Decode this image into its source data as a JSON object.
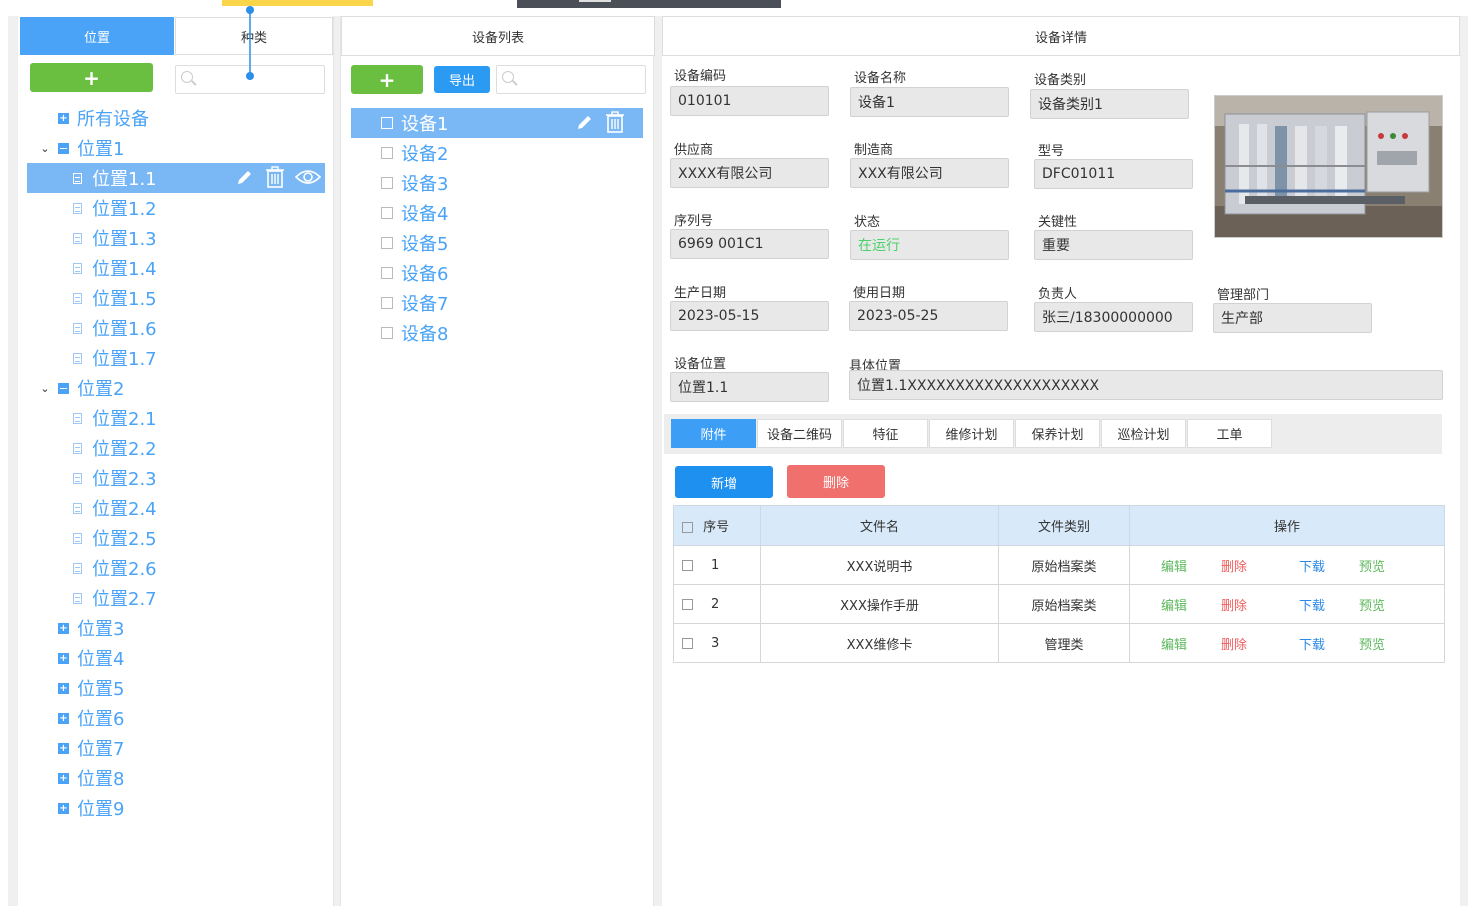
{
  "left_panel": {
    "tabs": [
      {
        "label": "位置",
        "active": true
      },
      {
        "label": "种类",
        "active": false
      }
    ],
    "add_label": "+",
    "search_placeholder": "",
    "tree": [
      {
        "label": "所有设备",
        "level": 0,
        "type": "plus"
      },
      {
        "label": "位置1",
        "level": 0,
        "type": "minus",
        "expanded": true
      },
      {
        "label": "位置1.1",
        "level": 1,
        "type": "leaf",
        "selected": true
      },
      {
        "label": "位置1.2",
        "level": 1,
        "type": "leaf"
      },
      {
        "label": "位置1.3",
        "level": 1,
        "type": "leaf"
      },
      {
        "label": "位置1.4",
        "level": 1,
        "type": "leaf"
      },
      {
        "label": "位置1.5",
        "level": 1,
        "type": "leaf"
      },
      {
        "label": "位置1.6",
        "level": 1,
        "type": "leaf"
      },
      {
        "label": "位置1.7",
        "level": 1,
        "type": "leaf"
      },
      {
        "label": "位置2",
        "level": 0,
        "type": "minus",
        "expanded": true
      },
      {
        "label": "位置2.1",
        "level": 1,
        "type": "leaf"
      },
      {
        "label": "位置2.2",
        "level": 1,
        "type": "leaf"
      },
      {
        "label": "位置2.3",
        "level": 1,
        "type": "leaf"
      },
      {
        "label": "位置2.4",
        "level": 1,
        "type": "leaf"
      },
      {
        "label": "位置2.5",
        "level": 1,
        "type": "leaf"
      },
      {
        "label": "位置2.6",
        "level": 1,
        "type": "leaf"
      },
      {
        "label": "位置2.7",
        "level": 1,
        "type": "leaf"
      },
      {
        "label": "位置3",
        "level": 0,
        "type": "plus"
      },
      {
        "label": "位置4",
        "level": 0,
        "type": "plus"
      },
      {
        "label": "位置5",
        "level": 0,
        "type": "plus"
      },
      {
        "label": "位置6",
        "level": 0,
        "type": "plus"
      },
      {
        "label": "位置7",
        "level": 0,
        "type": "plus"
      },
      {
        "label": "位置8",
        "level": 0,
        "type": "plus"
      },
      {
        "label": "位置9",
        "level": 0,
        "type": "plus"
      }
    ]
  },
  "middle_panel": {
    "title": "设备列表",
    "add_label": "+",
    "export_label": "导出",
    "devices": [
      {
        "label": "设备1",
        "selected": true
      },
      {
        "label": "设备2"
      },
      {
        "label": "设备3"
      },
      {
        "label": "设备4"
      },
      {
        "label": "设备5"
      },
      {
        "label": "设备6"
      },
      {
        "label": "设备7"
      },
      {
        "label": "设备8"
      }
    ]
  },
  "right_panel": {
    "title": "设备详情",
    "fields": {
      "code": {
        "label": "设备编码",
        "value": "010101"
      },
      "name": {
        "label": "设备名称",
        "value": "设备1"
      },
      "category": {
        "label": "设备类别",
        "value": "设备类别1"
      },
      "supplier": {
        "label": "供应商",
        "value": "XXXX有限公司"
      },
      "manufacturer": {
        "label": "制造商",
        "value": "XXX有限公司"
      },
      "model": {
        "label": "型号",
        "value": "DFC01011"
      },
      "serial": {
        "label": "序列号",
        "value": "6969 001C1"
      },
      "status": {
        "label": "状态",
        "value": "在运行"
      },
      "criticality": {
        "label": "关键性",
        "value": "重要"
      },
      "production_date": {
        "label": "生产日期",
        "value": "2023-05-15"
      },
      "use_date": {
        "label": "使用日期",
        "value": "2023-05-25"
      },
      "owner": {
        "label": "负责人",
        "value": "张三/18300000000"
      },
      "department": {
        "label": "管理部门",
        "value": "生产部"
      },
      "location": {
        "label": "设备位置",
        "value": "位置1.1"
      },
      "detail_location": {
        "label": "具体位置",
        "value": "位置1.1XXXXXXXXXXXXXXXXXXXX"
      }
    },
    "subtabs": [
      "附件",
      "设备二维码",
      "特征",
      "维修计划",
      "保养计划",
      "巡检计划",
      "工单"
    ],
    "add_label": "新增",
    "delete_label": "删除",
    "table": {
      "headers": [
        "序号",
        "文件名",
        "文件类别",
        "操作"
      ],
      "rows": [
        {
          "no": "1",
          "file": "XXX说明书",
          "type": "原始档案类"
        },
        {
          "no": "2",
          "file": "XXX操作手册",
          "type": "原始档案类"
        },
        {
          "no": "3",
          "file": "XXX维修卡",
          "type": "管理类"
        }
      ],
      "actions": {
        "edit": "编辑",
        "delete": "删除",
        "download": "下载",
        "preview": "预览"
      }
    }
  },
  "colors": {
    "accent": "#4aa3f7",
    "selected_row": "#7ab8f5",
    "green": "#6abf40",
    "danger": "#f0706d"
  }
}
